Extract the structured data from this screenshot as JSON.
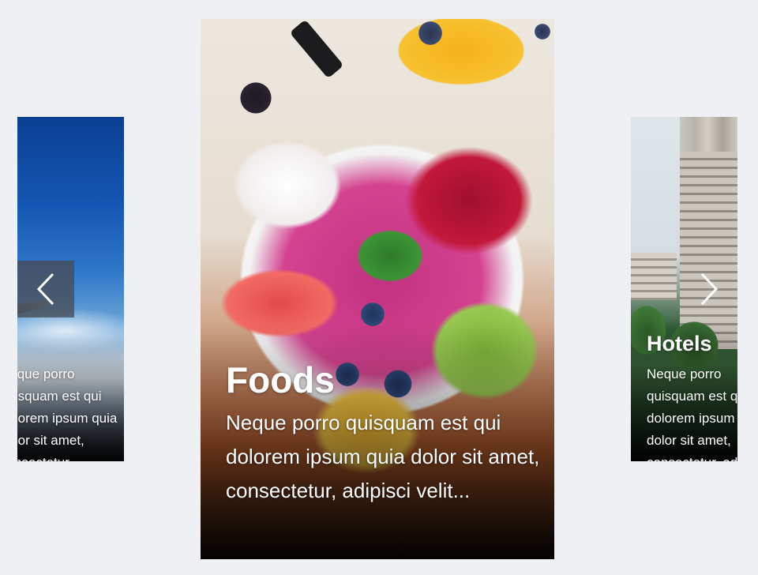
{
  "carousel": {
    "cards": [
      {
        "id": "left",
        "title": "",
        "description": "Neque porro quisquam est qui dolorem ipsum quia dolor sit amet, consectetur,"
      },
      {
        "id": "center",
        "title": "Foods",
        "description": "Neque porro quisquam est qui dolorem ipsum quia dolor sit amet, consectetur, adipisci velit..."
      },
      {
        "id": "right",
        "title": "Hotels",
        "description": "Neque porro quisquam est qui dolorem ipsum quia dolor sit amet, consectetur, adipisci velit..."
      }
    ],
    "prev_icon": "chevron-left-icon",
    "next_icon": "chevron-right-icon"
  }
}
